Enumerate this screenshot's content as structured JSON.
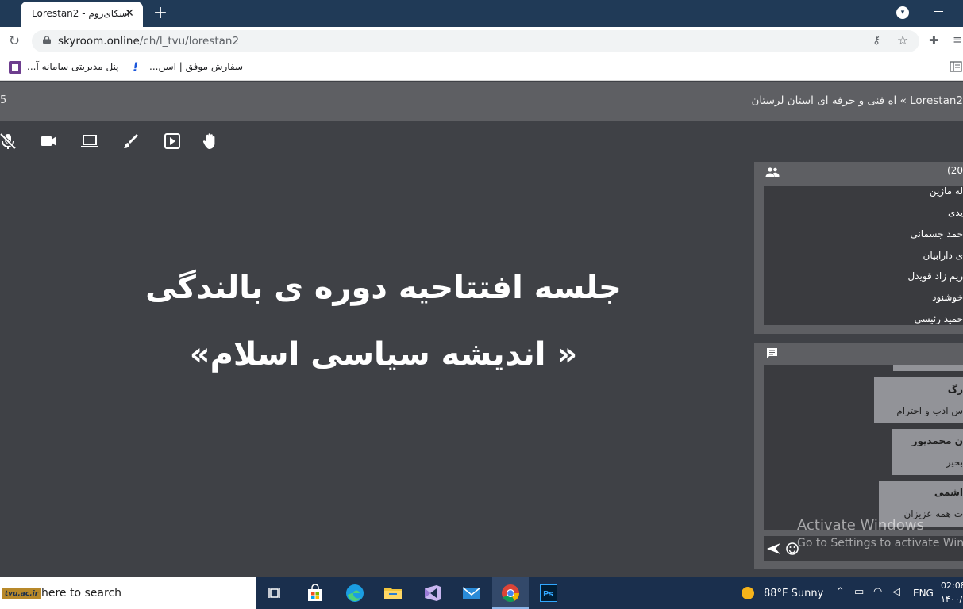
{
  "browser": {
    "tab": {
      "title": "اسکای‌روم - Lorestan2",
      "close": "✕"
    },
    "new_tab": "+",
    "url": {
      "host": "skyroom.online",
      "path": "/ch/l_tvu/lorestan2"
    },
    "bookmarks": [
      {
        "label": "پنل مدیریتی سامانه آ..."
      },
      {
        "label": "سفارش موفق | اسن..."
      }
    ]
  },
  "room": {
    "header_left": "5",
    "title": "Lorestan2 » اه فنی و حرفه ای استان لرستان"
  },
  "toolbar": {
    "icons": [
      "mic-off-icon",
      "camera-icon",
      "screen-share-icon",
      "brush-icon",
      "play-media-icon",
      "raise-hand-icon"
    ]
  },
  "slide": {
    "line1": "جلسه افتتاحیه دوره ی بالندگی",
    "line2": "« اندیشه سیاسی اسلام»"
  },
  "users": {
    "count": "(20",
    "list": [
      "له ماژین",
      "یدی",
      "حمد جسمانی",
      "ی دارابیان",
      "ریم زاد قویدل",
      "خوشنود",
      "حمید رئیسی"
    ]
  },
  "chat": {
    "messages": [
      {
        "name": "رگ",
        "text": "س ادب و احترام"
      },
      {
        "name": "ن محمدپور",
        "text": "بخیر"
      },
      {
        "name": "اشمی",
        "text": "ت همه عزیزان"
      }
    ]
  },
  "watermark": {
    "line1": "Activate Windows",
    "line2": "Go to Settings to activate Wind"
  },
  "taskbar": {
    "logo": "tvu.ac.ir",
    "search_placeholder": "here to search",
    "weather": "88°F  Sunny",
    "lang": "ENG",
    "time": "02:08",
    "date": "۱۴۰۰/۰"
  }
}
